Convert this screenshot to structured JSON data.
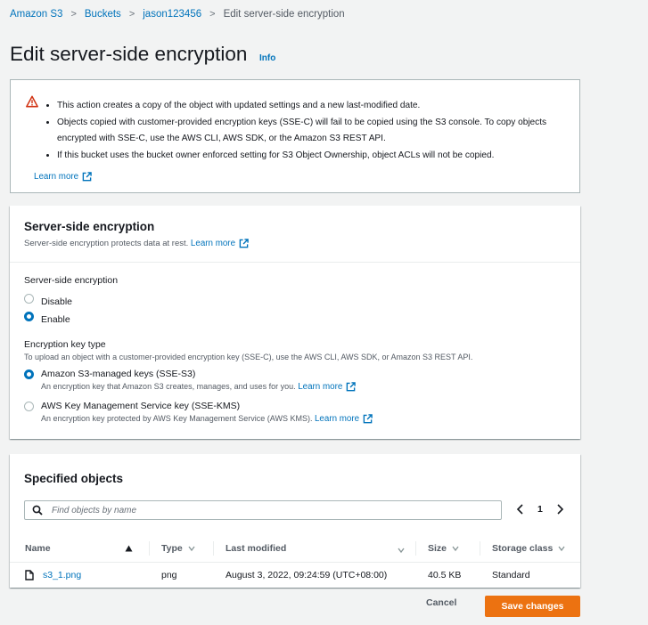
{
  "breadcrumb": {
    "items": [
      "Amazon S3",
      "Buckets",
      "jason123456"
    ],
    "current": "Edit server-side encryption"
  },
  "page": {
    "title": "Edit server-side encryption",
    "info": "Info"
  },
  "warning": {
    "bullets": [
      "This action creates a copy of the object with updated settings and a new last-modified date.",
      "Objects copied with customer-provided encryption keys (SSE-C) will fail to be copied using the S3 console. To copy objects encrypted with SSE-C, use the AWS CLI, AWS SDK, or the Amazon S3 REST API.",
      "If this bucket uses the bucket owner enforced setting for S3 Object Ownership, object ACLs will not be copied."
    ],
    "learn_more": "Learn more"
  },
  "encryption": {
    "title": "Server-side encryption",
    "description": "Server-side encryption protects data at rest.",
    "learn_more": "Learn more",
    "field_label": "Server-side encryption",
    "options": [
      {
        "label": "Disable",
        "checked": false
      },
      {
        "label": "Enable",
        "checked": true
      }
    ],
    "key_type_label": "Encryption key type",
    "key_type_desc": "To upload an object with a customer-provided encryption key (SSE-C), use the AWS CLI, AWS SDK, or Amazon S3 REST API.",
    "key_types": [
      {
        "label": "Amazon S3-managed keys (SSE-S3)",
        "desc": "An encryption key that Amazon S3 creates, manages, and uses for you.",
        "learn_more": "Learn more",
        "checked": true
      },
      {
        "label": "AWS Key Management Service key (SSE-KMS)",
        "desc": "An encryption key protected by AWS Key Management Service (AWS KMS).",
        "learn_more": "Learn more",
        "checked": false
      }
    ]
  },
  "objects": {
    "title": "Specified objects",
    "search_placeholder": "Find objects by name",
    "page_number": "1",
    "columns": [
      "Name",
      "Type",
      "Last modified",
      "Size",
      "Storage class"
    ],
    "rows": [
      {
        "name": "s3_1.png",
        "type": "png",
        "last_modified": "August 3, 2022, 09:24:59 (UTC+08:00)",
        "size": "40.5 KB",
        "storage_class": "Standard"
      }
    ]
  },
  "footer": {
    "cancel": "Cancel",
    "save": "Save changes"
  },
  "colors": {
    "link": "#0073bb",
    "primary_button": "#ec7211",
    "warning_icon": "#d13212"
  }
}
